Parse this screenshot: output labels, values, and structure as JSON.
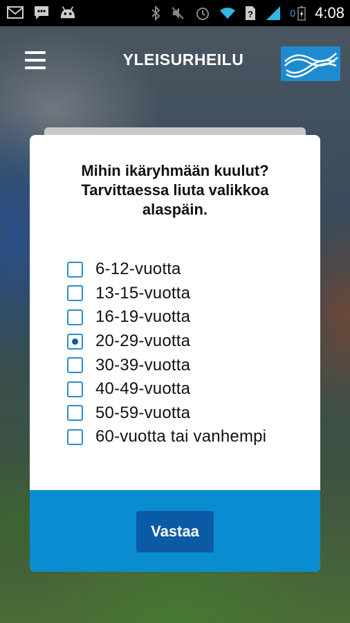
{
  "status_bar": {
    "left_icons": [
      "mail-icon",
      "chat-icon",
      "android-icon"
    ],
    "right_icons": [
      "bluetooth-icon",
      "mute-icon",
      "alarm-icon",
      "wifi-icon",
      "sim-unknown-icon",
      "signal-icon",
      "battery-icon"
    ],
    "battery_percent": "0",
    "time": "4:08"
  },
  "header": {
    "title": "YLEISURHEILU",
    "menu_icon": "hamburger-menu-icon",
    "logo": "sul-logo"
  },
  "dialog": {
    "question": "Mihin ikäryhmään kuulut? Tarvittaessa liuta valikkoa alaspäin.",
    "options": [
      {
        "label": " 6-12-vuotta",
        "checked": false
      },
      {
        "label": "13-15-vuotta",
        "checked": false
      },
      {
        "label": "16-19-vuotta",
        "checked": false
      },
      {
        "label": "20-29-vuotta",
        "checked": true
      },
      {
        "label": "30-39-vuotta",
        "checked": false
      },
      {
        "label": "40-49-vuotta",
        "checked": false
      },
      {
        "label": "50-59-vuotta",
        "checked": false
      },
      {
        "label": "60-vuotta tai vanhempi",
        "checked": false
      }
    ],
    "submit_label": "Vastaa"
  },
  "colors": {
    "accent": "#0a8dd0",
    "button": "#0a5aa6",
    "checkbox_border": "#2a8fd0",
    "status_blue": "#33b5e5"
  }
}
